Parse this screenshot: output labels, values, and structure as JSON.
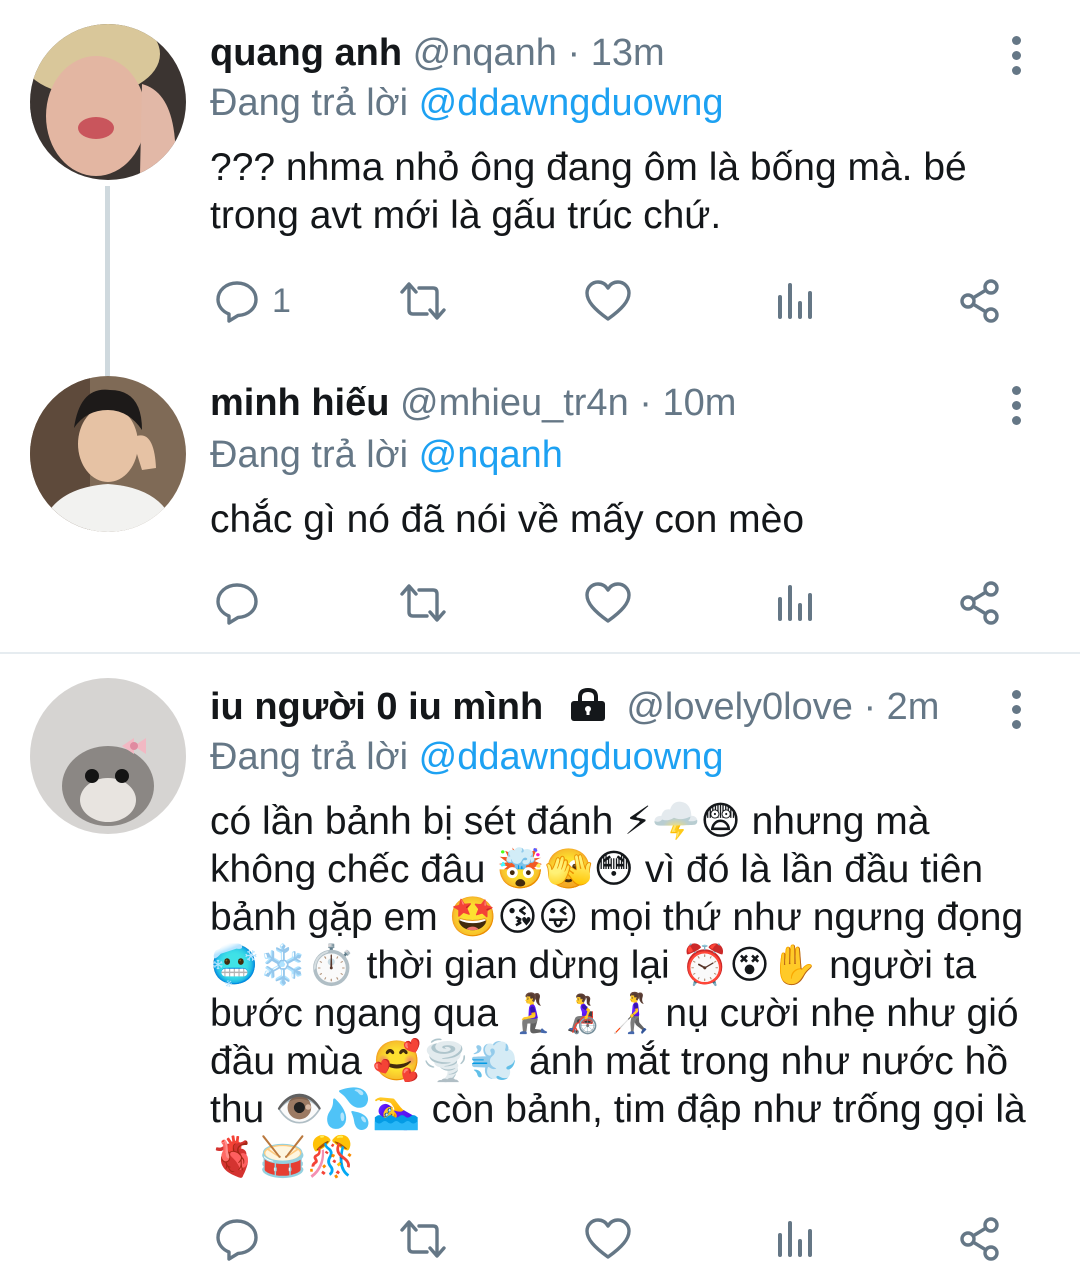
{
  "tweets": [
    {
      "name": "quang anh",
      "handle": "@nqanh",
      "separator": "·",
      "time": "13m",
      "reply_prefix": "Đang trả lời",
      "reply_to": "@ddawngduowng",
      "text": "??? nhma nhỏ ông đang ôm là bống mà. bé trong avt mới là gấu trúc chứ.",
      "reply_count": "1"
    },
    {
      "name": "minh hiếu",
      "handle": "@mhieu_tr4n",
      "separator": "·",
      "time": "10m",
      "reply_prefix": "Đang trả lời",
      "reply_to": "@nqanh",
      "text": "chắc gì nó đã nói về mấy con mèo",
      "reply_count": ""
    },
    {
      "name": "iu người 0 iu mình",
      "handle": "@lovely0love",
      "separator": "·",
      "time": "2m",
      "reply_prefix": "Đang trả lời",
      "reply_to": "@ddawngduowng",
      "text": "có lần bảnh bị sét đánh ⚡🌩️😨 nhưng mà không chếc đâu 🤯🫣😳 vì đó là lần đầu tiên bảnh gặp em 🤩😘😜 mọi thứ như ngưng đọng 🥶❄️⏱️ thời gian dừng lại ⏰😵✋ người ta bước ngang qua 🧎‍♀️👩‍🦽👩‍🦯 nụ cười nhẹ như gió đầu mùa 🥰🌪️💨 ánh mắt trong như nước hồ thu 👁️💦🏊‍♀️ còn bảnh, tim đập như trống gọi là 🫀🥁🎊",
      "reply_count": ""
    }
  ],
  "icons": [
    "reply-icon",
    "retweet-icon",
    "like-icon",
    "analytics-icon",
    "share-icon",
    "more-options-icon",
    "lock-icon"
  ],
  "colors": {
    "link": "#1da1f2",
    "secondary": "#657786",
    "thread_line": "#cfd9de"
  }
}
